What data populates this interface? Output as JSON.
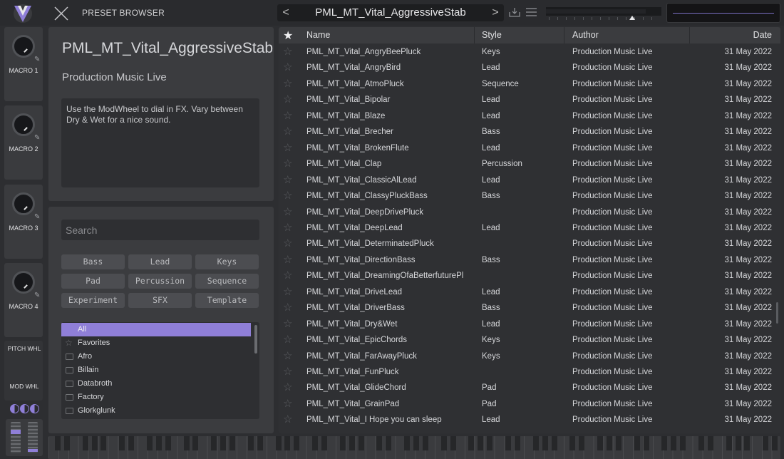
{
  "header": {
    "title": "PRESET BROWSER",
    "preset_name": "PML_MT_Vital_AggressiveStab",
    "prev_label": "<",
    "next_label": ">"
  },
  "macros": [
    {
      "label": "MACRO 1"
    },
    {
      "label": "MACRO 2"
    },
    {
      "label": "MACRO 3"
    },
    {
      "label": "MACRO 4"
    }
  ],
  "wheels": {
    "pitch_label": "PITCH WHL",
    "mod_label": "MOD WHL"
  },
  "info": {
    "name": "PML_MT_Vital_AggressiveStab",
    "author": "Production Music Live",
    "description": "Use the ModWheel to dial in FX. Vary between Dry & Wet for a nice sound."
  },
  "filter": {
    "search_placeholder": "Search",
    "styles": [
      "Bass",
      "Lead",
      "Keys",
      "Pad",
      "Percussion",
      "Sequence",
      "Experiment",
      "SFX",
      "Template"
    ],
    "folders": [
      {
        "name": "All",
        "selected": true,
        "icon": "none"
      },
      {
        "name": "Favorites",
        "selected": false,
        "icon": "star-icon"
      },
      {
        "name": "Afro",
        "selected": false,
        "icon": "folder-icon"
      },
      {
        "name": "Billain",
        "selected": false,
        "icon": "folder-icon"
      },
      {
        "name": "Databroth",
        "selected": false,
        "icon": "folder-icon"
      },
      {
        "name": "Factory",
        "selected": false,
        "icon": "folder-icon"
      },
      {
        "name": "Glorkglunk",
        "selected": false,
        "icon": "folder-icon"
      }
    ]
  },
  "table": {
    "columns": {
      "name": "Name",
      "style": "Style",
      "author": "Author",
      "date": "Date"
    },
    "rows": [
      {
        "name": "PML_MT_Vital_AngryBeePluck",
        "style": "Keys",
        "author": "Production Music Live",
        "date": "31 May 2022"
      },
      {
        "name": "PML_MT_Vital_AngryBird",
        "style": "Lead",
        "author": "Production Music Live",
        "date": "31 May 2022"
      },
      {
        "name": "PML_MT_Vital_AtmoPluck",
        "style": "Sequence",
        "author": "Production Music Live",
        "date": "31 May 2022"
      },
      {
        "name": "PML_MT_Vital_Bipolar",
        "style": "Lead",
        "author": "Production Music Live",
        "date": "31 May 2022"
      },
      {
        "name": "PML_MT_Vital_Blaze",
        "style": "Lead",
        "author": "Production Music Live",
        "date": "31 May 2022"
      },
      {
        "name": "PML_MT_Vital_Brecher",
        "style": "Bass",
        "author": "Production Music Live",
        "date": "31 May 2022"
      },
      {
        "name": "PML_MT_Vital_BrokenFlute",
        "style": "Lead",
        "author": "Production Music Live",
        "date": "31 May 2022"
      },
      {
        "name": "PML_MT_Vital_Clap",
        "style": "Percussion",
        "author": "Production Music Live",
        "date": "31 May 2022"
      },
      {
        "name": "PML_MT_Vital_ClassicAlLead",
        "style": "Lead",
        "author": "Production Music Live",
        "date": "31 May 2022"
      },
      {
        "name": "PML_MT_Vital_ClassyPluckBass",
        "style": "Bass",
        "author": "Production Music Live",
        "date": "31 May 2022"
      },
      {
        "name": "PML_MT_Vital_DeepDrivePluck",
        "style": "",
        "author": "Production Music Live",
        "date": "31 May 2022"
      },
      {
        "name": "PML_MT_Vital_DeepLead",
        "style": "Lead",
        "author": "Production Music Live",
        "date": "31 May 2022"
      },
      {
        "name": "PML_MT_Vital_DeterminatedPluck",
        "style": "",
        "author": "Production Music Live",
        "date": "31 May 2022"
      },
      {
        "name": "PML_MT_Vital_DirectionBass",
        "style": "Bass",
        "author": "Production Music Live",
        "date": "31 May 2022"
      },
      {
        "name": "PML_MT_Vital_DreamingOfaBetterfuturePl...",
        "style": "",
        "author": "Production Music Live",
        "date": "31 May 2022"
      },
      {
        "name": "PML_MT_Vital_DriveLead",
        "style": "Lead",
        "author": "Production Music Live",
        "date": "31 May 2022"
      },
      {
        "name": "PML_MT_Vital_DriverBass",
        "style": "Bass",
        "author": "Production Music Live",
        "date": "31 May 2022"
      },
      {
        "name": "PML_MT_Vital_Dry&Wet",
        "style": "Lead",
        "author": "Production Music Live",
        "date": "31 May 2022"
      },
      {
        "name": "PML_MT_Vital_EpicChords",
        "style": "Keys",
        "author": "Production Music Live",
        "date": "31 May 2022"
      },
      {
        "name": "PML_MT_Vital_FarAwayPluck",
        "style": "Keys",
        "author": "Production Music Live",
        "date": "31 May 2022"
      },
      {
        "name": "PML_MT_Vital_FunPluck",
        "style": "",
        "author": "Production Music Live",
        "date": "31 May 2022"
      },
      {
        "name": "PML_MT_Vital_GlideChord",
        "style": "Pad",
        "author": "Production Music Live",
        "date": "31 May 2022"
      },
      {
        "name": "PML_MT_Vital_GrainPad",
        "style": "Pad",
        "author": "Production Music Live",
        "date": "31 May 2022"
      },
      {
        "name": "PML_MT_Vital_I Hope you can sleep",
        "style": "Lead",
        "author": "Production Music Live",
        "date": "31 May 2022"
      }
    ]
  },
  "colors": {
    "accent": "#8f7fd8",
    "panel": "#3b3c3f",
    "background": "#2d2e31"
  }
}
